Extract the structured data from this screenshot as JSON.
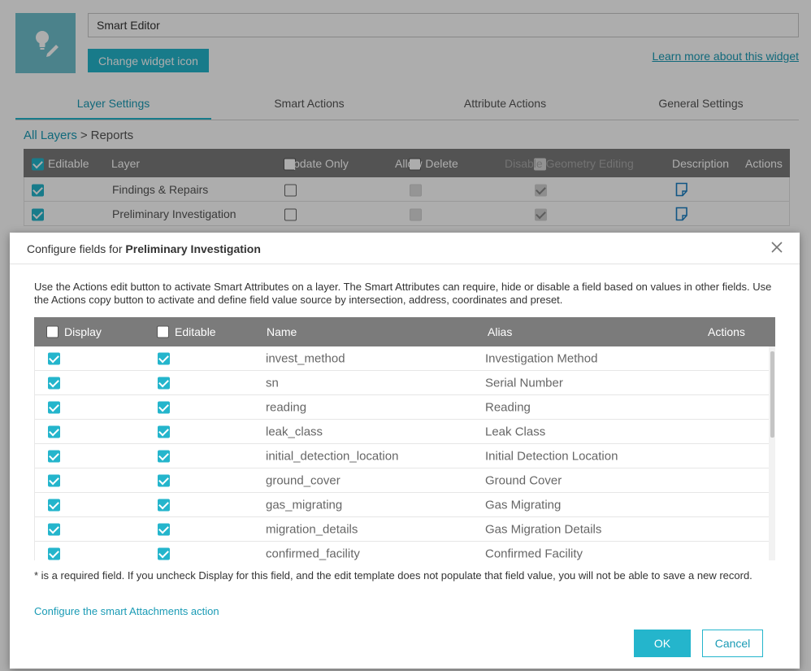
{
  "widget": {
    "name_value": "Smart Editor",
    "change_icon_label": "Change widget icon",
    "learn_more_label": "Learn more about this widget"
  },
  "tabs": [
    {
      "label": "Layer Settings",
      "active": true
    },
    {
      "label": "Smart Actions",
      "active": false
    },
    {
      "label": "Attribute Actions",
      "active": false
    },
    {
      "label": "General Settings",
      "active": false
    }
  ],
  "breadcrumb": {
    "root": "All Layers",
    "separator": ">",
    "current": "Reports"
  },
  "layer_table": {
    "headers": {
      "editable": "Editable",
      "layer": "Layer",
      "update_only": "Update Only",
      "allow_delete": "Allow Delete",
      "disable_geometry": "Disable Geometry Editing",
      "description": "Description",
      "actions": "Actions"
    },
    "rows": [
      {
        "layer": "Findings & Repairs"
      },
      {
        "layer": "Preliminary Investigation"
      }
    ]
  },
  "dialog": {
    "title_prefix": "Configure fields for ",
    "title_layer": "Preliminary Investigation",
    "description": "Use the Actions edit button to activate Smart Attributes on a layer. The Smart Attributes can require, hide or disable a field based on values in other fields. Use the Actions copy button to activate and define field value source by intersection, address, coordinates and preset.",
    "field_headers": {
      "display": "Display",
      "editable": "Editable",
      "name": "Name",
      "alias": "Alias",
      "actions": "Actions"
    },
    "fields": [
      {
        "name": "invest_method",
        "alias": "Investigation Method"
      },
      {
        "name": "sn",
        "alias": "Serial Number"
      },
      {
        "name": "reading",
        "alias": "Reading"
      },
      {
        "name": "leak_class",
        "alias": "Leak Class"
      },
      {
        "name": "initial_detection_location",
        "alias": "Initial Detection Location"
      },
      {
        "name": "ground_cover",
        "alias": "Ground Cover"
      },
      {
        "name": "gas_migrating",
        "alias": "Gas Migrating"
      },
      {
        "name": "migration_details",
        "alias": "Gas Migration Details"
      },
      {
        "name": "confirmed_facility",
        "alias": "Confirmed Facility"
      }
    ],
    "note": "* is a required field. If you uncheck Display for this field, and the edit template does not populate that field value, you will not be able to save a new record.",
    "attachments_link": "Configure the smart Attachments action",
    "ok_label": "OK",
    "cancel_label": "Cancel"
  },
  "colors": {
    "accent": "#24b5cc",
    "header_gray": "#7b7b7b",
    "link": "#1a9bb5"
  }
}
